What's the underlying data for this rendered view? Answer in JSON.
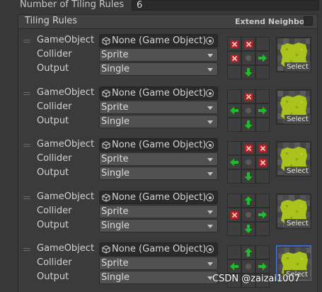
{
  "settings": {
    "label": "Number of Tiling Rules",
    "value": "6"
  },
  "list": {
    "title": "Tiling Rules",
    "extend_label": "Extend Neighbor"
  },
  "labels": {
    "gameobject": "GameObject",
    "collider": "Collider",
    "output": "Output"
  },
  "select_label": "Select",
  "colors": {
    "accent_green": "#1bb524",
    "accent_red": "#c8282b",
    "tile_green": "#aac21c",
    "select_border": "#3a6dcc"
  },
  "icons": {
    "gameobject": "cube-icon",
    "picker": "object-picker-icon",
    "handle": "drag-handle-icon",
    "dropdown": "chevron-down-icon"
  },
  "rules": [
    {
      "gameobject": "None (Game Object)",
      "collider": "Sprite",
      "output": "Single",
      "neighbors": [
        "x",
        "x",
        "",
        "x",
        "",
        "right",
        "",
        "down",
        ""
      ],
      "preview_selected": false
    },
    {
      "gameobject": "None (Game Object)",
      "collider": "Sprite",
      "output": "Single",
      "neighbors": [
        "",
        "x",
        "",
        "left",
        "",
        "right",
        "",
        "down",
        ""
      ],
      "preview_selected": false
    },
    {
      "gameobject": "None (Game Object)",
      "collider": "Sprite",
      "output": "Single",
      "neighbors": [
        "",
        "x",
        "x",
        "left",
        "",
        "x",
        "",
        "down",
        ""
      ],
      "preview_selected": false
    },
    {
      "gameobject": "None (Game Object)",
      "collider": "Sprite",
      "output": "Single",
      "neighbors": [
        "",
        "up",
        "",
        "x",
        "",
        "right",
        "",
        "down",
        ""
      ],
      "preview_selected": false
    },
    {
      "gameobject": "None (Game Object)",
      "collider": "Sprite",
      "output": "Single",
      "neighbors": [
        "",
        "up",
        "",
        "left",
        "",
        "right",
        "",
        "",
        ""
      ],
      "preview_selected": true
    }
  ],
  "watermark": "CSDN @zaizai1007"
}
